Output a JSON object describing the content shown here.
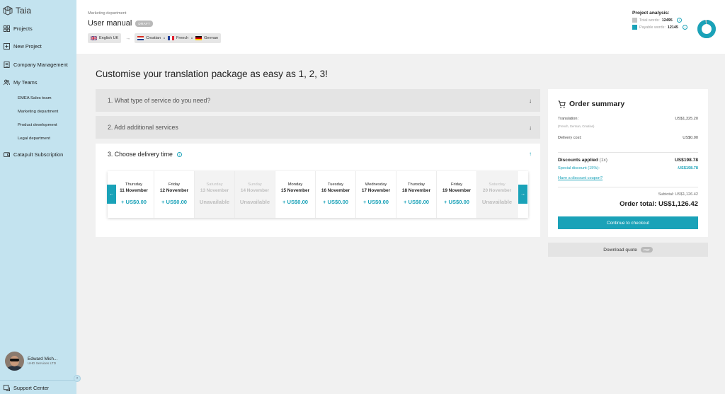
{
  "app": {
    "name": "Taia"
  },
  "sidebar": {
    "items": [
      {
        "label": "Projects",
        "icon": "grid-icon"
      },
      {
        "label": "New Project",
        "icon": "plus-square-icon"
      },
      {
        "label": "Company Management",
        "icon": "building-icon"
      },
      {
        "label": "My Teams",
        "icon": "users-icon"
      },
      {
        "label": "Catapult Subscription",
        "icon": "wallet-icon"
      }
    ],
    "teams": [
      "EMEA Sales team",
      "Marketing department",
      "Product development",
      "Legal department"
    ],
    "user": {
      "name": "Edward Mich...",
      "company": "UHD Services LTD"
    },
    "support": "Support Center"
  },
  "header": {
    "department": "Marketing department",
    "title": "User manual",
    "badge": "DRAFT",
    "source_language": "English UK",
    "target_languages": [
      "Croatian",
      "French",
      "German"
    ]
  },
  "analysis": {
    "title": "Project analysis:",
    "total_label": "Total words:",
    "total_value": "12495",
    "payable_label": "Payable words:",
    "payable_value": "12145",
    "payable_fraction": 0.972,
    "colors": {
      "total": "#c4c4c4",
      "payable": "#1aa2b8"
    }
  },
  "main": {
    "heading": "Customise your translation package as easy as 1, 2, 3!",
    "step1": "1. What type of service do you need?",
    "step2": "2. Add additional services",
    "step3": "3. Choose delivery time",
    "dates": [
      {
        "day": "Thursday",
        "date": "11 November",
        "price": "+ US$0.00",
        "available": true
      },
      {
        "day": "Friday",
        "date": "12 November",
        "price": "+ US$0.00",
        "available": true
      },
      {
        "day": "Saturday",
        "date": "13 November",
        "price": "Unavailable",
        "available": false
      },
      {
        "day": "Sunday",
        "date": "14 November",
        "price": "Unavailable",
        "available": false
      },
      {
        "day": "Monday",
        "date": "15 November",
        "price": "+ US$0.00",
        "available": true
      },
      {
        "day": "Tuesday",
        "date": "16 November",
        "price": "+ US$0.00",
        "available": true
      },
      {
        "day": "Wednesday",
        "date": "17 November",
        "price": "+ US$0.00",
        "available": true
      },
      {
        "day": "Thursday",
        "date": "18 November",
        "price": "+ US$0.00",
        "available": true
      },
      {
        "day": "Friday",
        "date": "19 November",
        "price": "+ US$0.00",
        "available": true
      },
      {
        "day": "Saturday",
        "date": "20 November",
        "price": "Unavailable",
        "available": false
      }
    ]
  },
  "summary": {
    "title": "Order summary",
    "translation_label": "Translation:",
    "translation_value": "US$1,325.20",
    "translation_note": "(French, German, Croatian)",
    "delivery_label": "Delivery cost:",
    "delivery_value": "US$0.00",
    "discounts_label": "Discounts applied",
    "discounts_count": "(1x)",
    "discounts_value": "US$198.78",
    "special_label": "Special discount (15%):",
    "special_value": "-US$198.78",
    "coupon_link": "Have a discount coupon?",
    "subtotal": "Subtotal: US$1,126.42",
    "total": "Order total: US$1,126.42",
    "checkout_label": "Continue to checkout",
    "download_label": "Download quote",
    "download_badge": "PDF"
  },
  "colors": {
    "accent": "#1aa2b8",
    "sidebar": "#c3e3ef"
  }
}
